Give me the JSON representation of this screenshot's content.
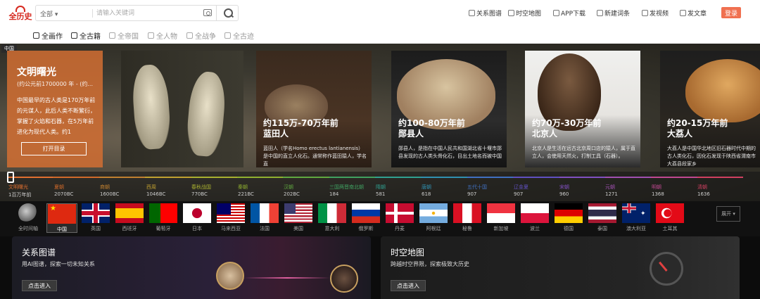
{
  "logo": {
    "text": "全历史"
  },
  "search": {
    "scope": "全部",
    "placeholder": "请输入关键词"
  },
  "toplinks": [
    {
      "label": "关系图谱",
      "icon": "relation-icon"
    },
    {
      "label": "时空地图",
      "icon": "map-icon"
    },
    {
      "label": "APP下载",
      "icon": "phone-icon"
    },
    {
      "label": "新建词条",
      "icon": "edit-icon"
    },
    {
      "label": "发视频",
      "icon": "video-icon"
    },
    {
      "label": "发文章",
      "icon": "article-icon"
    }
  ],
  "login": "登录",
  "categories": [
    {
      "label": "全画作",
      "active": true
    },
    {
      "label": "全古籍",
      "active": true
    },
    {
      "label": "全帝国",
      "active": false
    },
    {
      "label": "全人物",
      "active": false
    },
    {
      "label": "全战争",
      "active": false
    },
    {
      "label": "全古迹",
      "active": false
    }
  ],
  "hero": {
    "region": "中国",
    "intro_title": "文明曙光",
    "intro_date": "(约公元前1700000 年 - (约...",
    "intro_text": "中国最早的古人类是170万年前的元谋人，此后人类不断繁衍，掌握了火焰和石器，在5万年前进化为现代人类。约1",
    "open_button": "打开目录",
    "cards": [
      {
        "t1": "约115万-70万年前",
        "t2": "蓝田人",
        "t3": "蓝田人（学名Homo erectus lantianensis）是中国的直立人化石。通常称作蓝田猿人，学名直"
      },
      {
        "t1": "约100-80万年前",
        "t2": "郧县人",
        "t3": "郧县人，是指在中国人民共和国湖北省十堰市郧县发现的古人类头骨化石，目出土地名而被中国"
      },
      {
        "t1": "约70万-30万年前",
        "t2": "北京人",
        "t3": "北京人是生活在远古北京周口店的猿人，属于直立人，会使用天然火，打制工具（石器）。"
      },
      {
        "t1": "约20-15万年前",
        "t2": "大荔人",
        "t3": "大荔人是中国华北地区旧石器时代中期的古人类化石，因化石发现于陕西省渭南市大荔县段家乡"
      }
    ]
  },
  "eras": [
    {
      "name": "文明曙光",
      "year": "1百万年前",
      "color": "#e07030"
    },
    {
      "name": "夏朝",
      "year": "2070BC",
      "color": "#d06a2a"
    },
    {
      "name": "商朝",
      "year": "1600BC",
      "color": "#c08030"
    },
    {
      "name": "西周",
      "year": "1046BC",
      "color": "#c0a030"
    },
    {
      "name": "春秋战国",
      "year": "770BC",
      "color": "#a8b030"
    },
    {
      "name": "秦朝",
      "year": "221BC",
      "color": "#90b030"
    },
    {
      "name": "汉朝",
      "year": "202BC",
      "color": "#60a840"
    },
    {
      "name": "三国两晋南北朝",
      "year": "184",
      "color": "#40a060"
    },
    {
      "name": "隋朝",
      "year": "581",
      "color": "#30a090"
    },
    {
      "name": "唐朝",
      "year": "618",
      "color": "#3090b0"
    },
    {
      "name": "五代十国",
      "year": "907",
      "color": "#4070c0"
    },
    {
      "name": "辽金夏",
      "year": "907",
      "color": "#6050c0"
    },
    {
      "name": "宋朝",
      "year": "960",
      "color": "#8050c0"
    },
    {
      "name": "元朝",
      "year": "1271",
      "color": "#a050b0"
    },
    {
      "name": "明朝",
      "year": "1368",
      "color": "#c04890"
    },
    {
      "name": "清朝",
      "year": "1636",
      "color": "#d04060"
    }
  ],
  "countries": [
    {
      "label": "全时间轴",
      "flag": "globe"
    },
    {
      "label": "中国",
      "flag": "cn"
    },
    {
      "label": "英国",
      "flag": "gb"
    },
    {
      "label": "西班牙",
      "flag": "es"
    },
    {
      "label": "葡萄牙",
      "flag": "pt"
    },
    {
      "label": "日本",
      "flag": "jp"
    },
    {
      "label": "马来西亚",
      "flag": "my"
    },
    {
      "label": "法国",
      "flag": "fr"
    },
    {
      "label": "美国",
      "flag": "us"
    },
    {
      "label": "意大利",
      "flag": "it"
    },
    {
      "label": "俄罗斯",
      "flag": "ru"
    },
    {
      "label": "丹麦",
      "flag": "dk"
    },
    {
      "label": "阿根廷",
      "flag": "ar"
    },
    {
      "label": "秘鲁",
      "flag": "pe"
    },
    {
      "label": "新加坡",
      "flag": "sg"
    },
    {
      "label": "波兰",
      "flag": "pl"
    },
    {
      "label": "德国",
      "flag": "de"
    },
    {
      "label": "泰国",
      "flag": "th"
    },
    {
      "label": "澳大利亚",
      "flag": "au"
    },
    {
      "label": "土耳其",
      "flag": "tr"
    }
  ],
  "expand": "展开",
  "panels": [
    {
      "title": "关系图谱",
      "sub": "用AI图谱，探索一切未知关系",
      "button": "点击进入"
    },
    {
      "title": "时空地图",
      "sub": "跨越时空界限，探索极致大历史",
      "button": "点击进入"
    }
  ]
}
